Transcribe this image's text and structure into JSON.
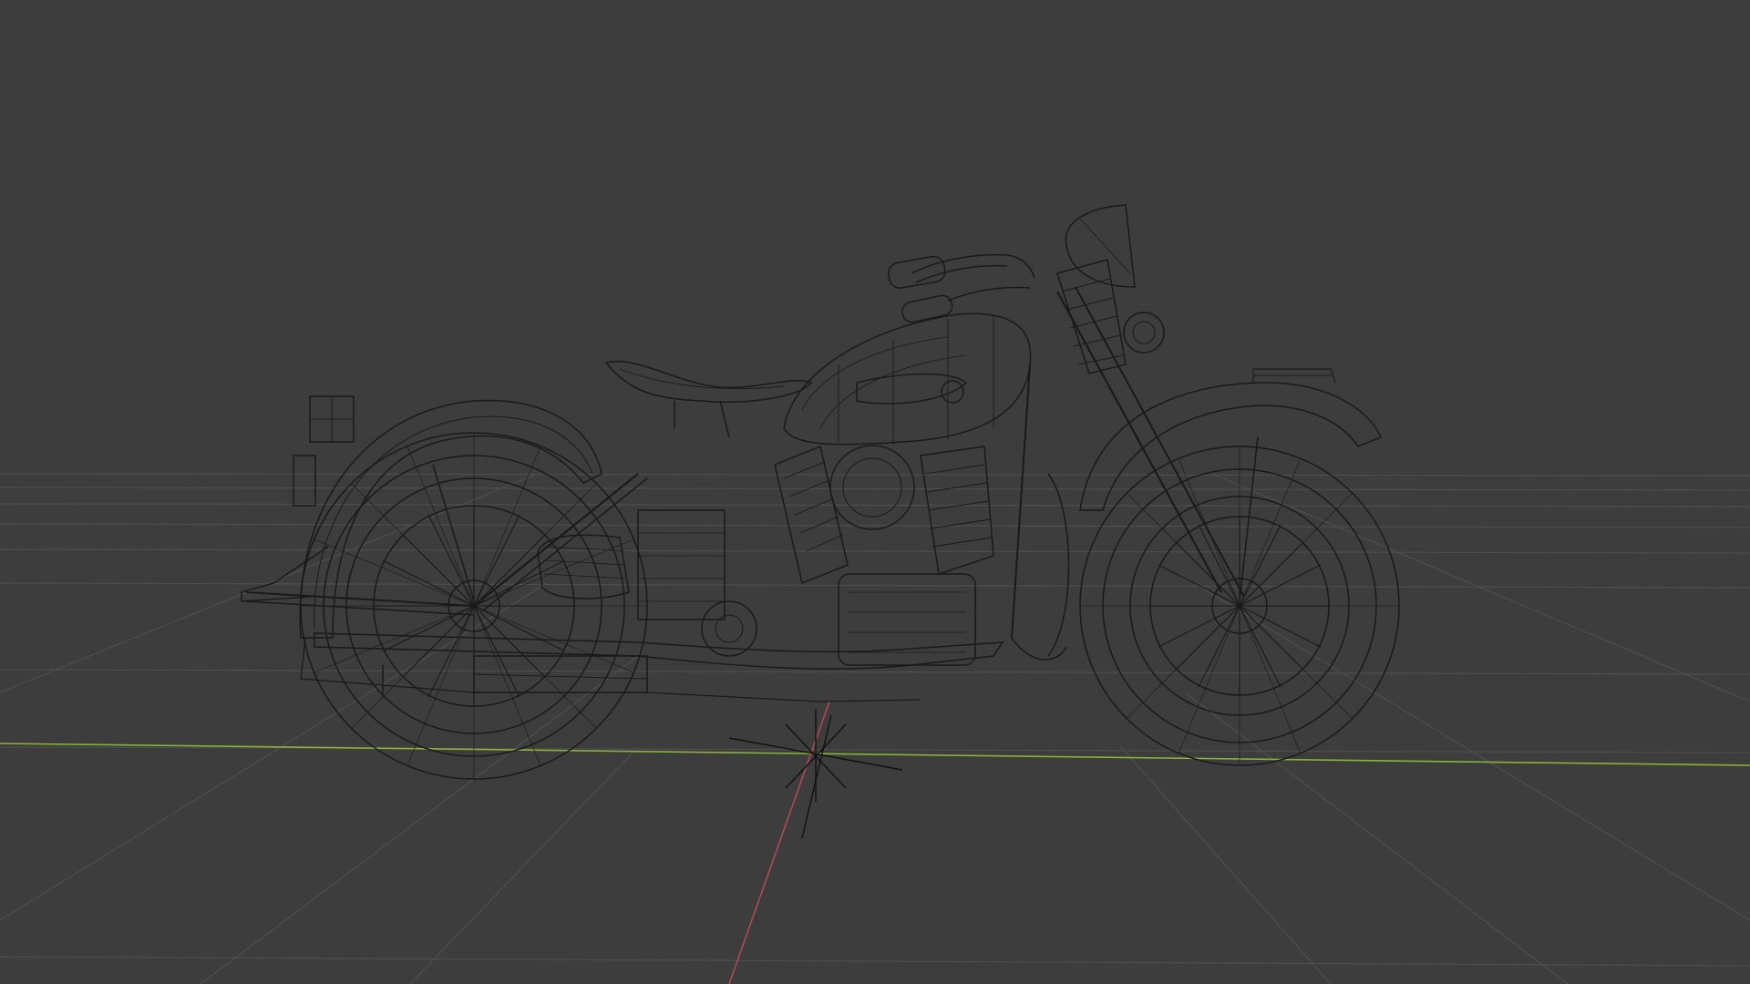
{
  "viewport": {
    "mode": "wireframe",
    "model": "motorcycle-wireframe",
    "colors": {
      "background": "#3d3d3d",
      "grid": "#545454",
      "x_axis": "#b04a58",
      "y_axis": "#8ab13a",
      "wire": "#1a1a1a"
    }
  }
}
